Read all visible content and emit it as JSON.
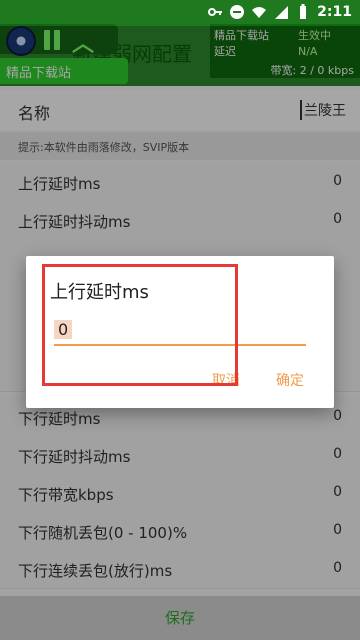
{
  "status_bar": {
    "time": "2:11"
  },
  "app_bar": {
    "title": "新建弱网配置"
  },
  "float_window": {
    "label": "精品下载站"
  },
  "info_panel": {
    "left_lines": [
      "精品下载站",
      "延迟"
    ],
    "right_lines": [
      "生效中",
      "N/A"
    ],
    "bandwidth": "带宽: 2 / 0 kbps"
  },
  "form": {
    "name_label": "名称",
    "name_value": "兰陵王",
    "tip": "提示:本软件由雨落修改，SVIP版本",
    "rows": [
      {
        "label": "上行延时ms",
        "value": "0"
      },
      {
        "label": "上行延时抖动ms",
        "value": "0"
      },
      {
        "label": "",
        "value": ""
      },
      {
        "label": "",
        "value": ""
      },
      {
        "label": "",
        "value": ""
      },
      {
        "label": "",
        "value": ""
      },
      {
        "label": "下行延时ms",
        "value": "0"
      },
      {
        "label": "下行延时抖动ms",
        "value": "0"
      },
      {
        "label": "下行带宽kbps",
        "value": "0"
      },
      {
        "label": "下行随机丢包(0 - 100)%",
        "value": "0"
      },
      {
        "label": "下行连续丢包(放行)ms",
        "value": "0"
      }
    ]
  },
  "dialog": {
    "title": "上行延时ms",
    "input_value": "0",
    "cancel_label": "取消",
    "ok_label": "确定"
  },
  "footer": {
    "save_label": "保存"
  },
  "colors": {
    "accent": "#2e8b2e",
    "dialog_accent": "#f39c4a",
    "highlight": "#e53935"
  }
}
